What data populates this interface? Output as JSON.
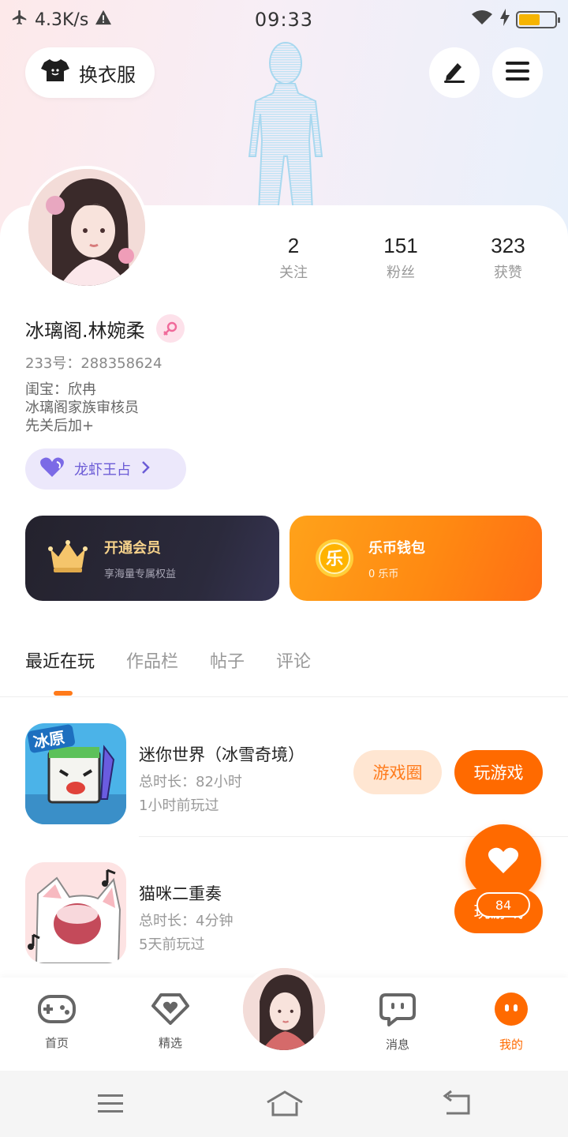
{
  "status_bar": {
    "network_speed": "4.3K/s",
    "time": "09:33"
  },
  "top_actions": {
    "dress_label": "换衣服"
  },
  "profile": {
    "stats": [
      {
        "value": "2",
        "label": "关注"
      },
      {
        "value": "151",
        "label": "粉丝"
      },
      {
        "value": "323",
        "label": "获赞"
      }
    ],
    "nickname": "冰璃阁.林婉柔",
    "uid": "233号：288358624",
    "bio": [
      "闺宝：欣冉",
      "冰璃阁家族审核员",
      "先关后加+"
    ],
    "tag_label": "龙虾王占"
  },
  "cards": {
    "vip": {
      "title": "开通会员",
      "subtitle": "享海量专属权益"
    },
    "wallet": {
      "title": "乐币钱包",
      "subtitle": "0 乐币",
      "coin_glyph": "乐"
    }
  },
  "tabs": [
    {
      "label": "最近在玩",
      "active": true
    },
    {
      "label": "作品栏",
      "active": false
    },
    {
      "label": "帖子",
      "active": false
    },
    {
      "label": "评论",
      "active": false
    }
  ],
  "games": [
    {
      "name": "迷你世界（冰雪奇境）",
      "duration": "总时长：82小时",
      "last_played": "1小时前玩过",
      "icon_text": "冰原",
      "circle_button": "游戏圈",
      "play_button": "玩游戏"
    },
    {
      "name": "猫咪二重奏",
      "duration": "总时长：4分钟",
      "last_played": "5天前玩过",
      "play_button": "玩游戏"
    }
  ],
  "fab": {
    "count": "84"
  },
  "bottom_nav": [
    {
      "label": "首页",
      "icon": "gamepad-icon"
    },
    {
      "label": "精选",
      "icon": "heart-diamond-icon"
    },
    {
      "label": "消息",
      "icon": "chat-icon"
    },
    {
      "label": "我的",
      "icon": "smiley-icon",
      "active": true
    }
  ],
  "colors": {
    "accent": "#ff6a00",
    "vip_gold": "#f6d28b",
    "tag_purple": "#6b5bd6"
  }
}
